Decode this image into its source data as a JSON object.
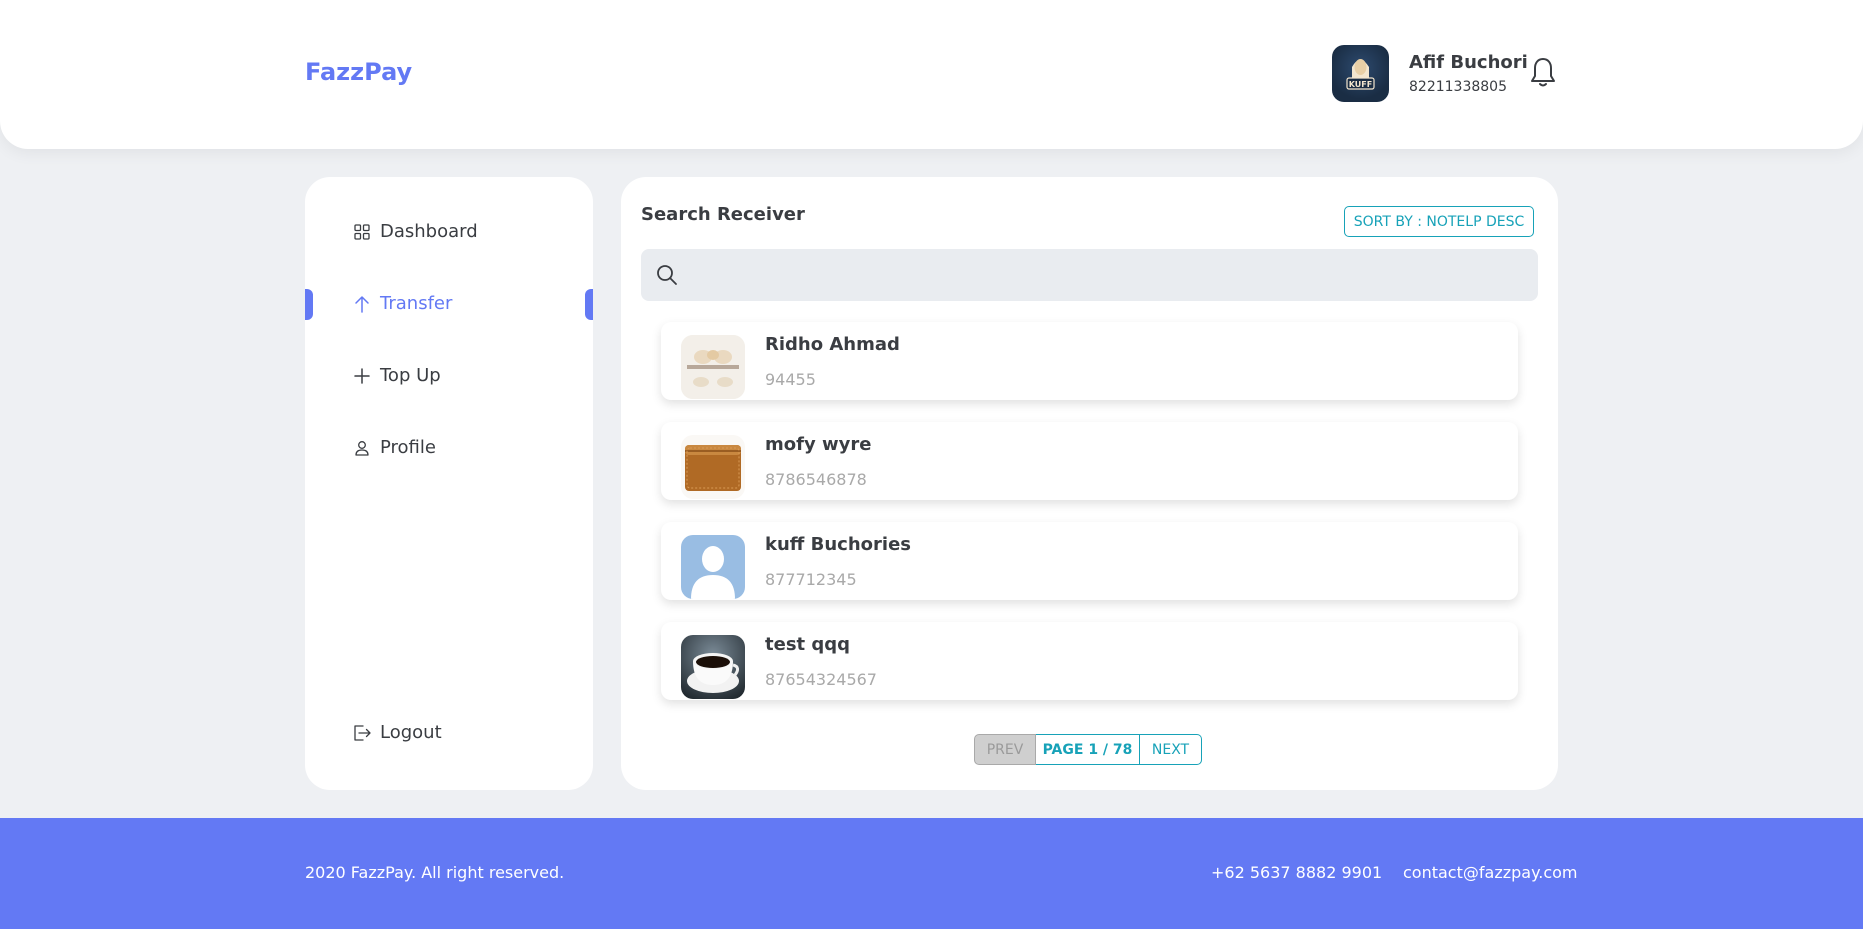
{
  "header": {
    "brand": "FazzPay",
    "user": {
      "name": "Afif Buchori",
      "phone": "82211338805"
    }
  },
  "sidebar": {
    "items": [
      {
        "label": "Dashboard",
        "icon": "grid-icon",
        "active": false
      },
      {
        "label": "Transfer",
        "icon": "arrow-up-icon",
        "active": true
      },
      {
        "label": "Top Up",
        "icon": "plus-icon",
        "active": false
      },
      {
        "label": "Profile",
        "icon": "user-icon",
        "active": false
      }
    ],
    "logout": {
      "label": "Logout",
      "icon": "logout-icon"
    }
  },
  "main": {
    "title": "Search Receiver",
    "sort_label": "SORT BY : NOTELP DESC",
    "search": {
      "placeholder": "",
      "value": ""
    },
    "receivers": [
      {
        "name": "Ridho Ahmad",
        "phone": "94455",
        "avatar": "food-photo"
      },
      {
        "name": "mofy wyre",
        "phone": "8786546878",
        "avatar": "wallet-photo"
      },
      {
        "name": "kuff Buchories",
        "phone": "877712345",
        "avatar": "default-user-avatar"
      },
      {
        "name": "test qqq",
        "phone": "87654324567",
        "avatar": "coffee-cup-photo"
      }
    ],
    "pagination": {
      "prev": "PREV",
      "page": "PAGE 1 / 78",
      "next": "NEXT"
    }
  },
  "footer": {
    "copyright": "2020 FazzPay. All right reserved.",
    "phone": "+62 5637 8882 9901",
    "email": "contact@fazzpay.com"
  },
  "colors": {
    "primary": "#6379f4",
    "accent": "#17a2b8",
    "text": "#3a3d42",
    "muted": "#a9a9a9"
  }
}
